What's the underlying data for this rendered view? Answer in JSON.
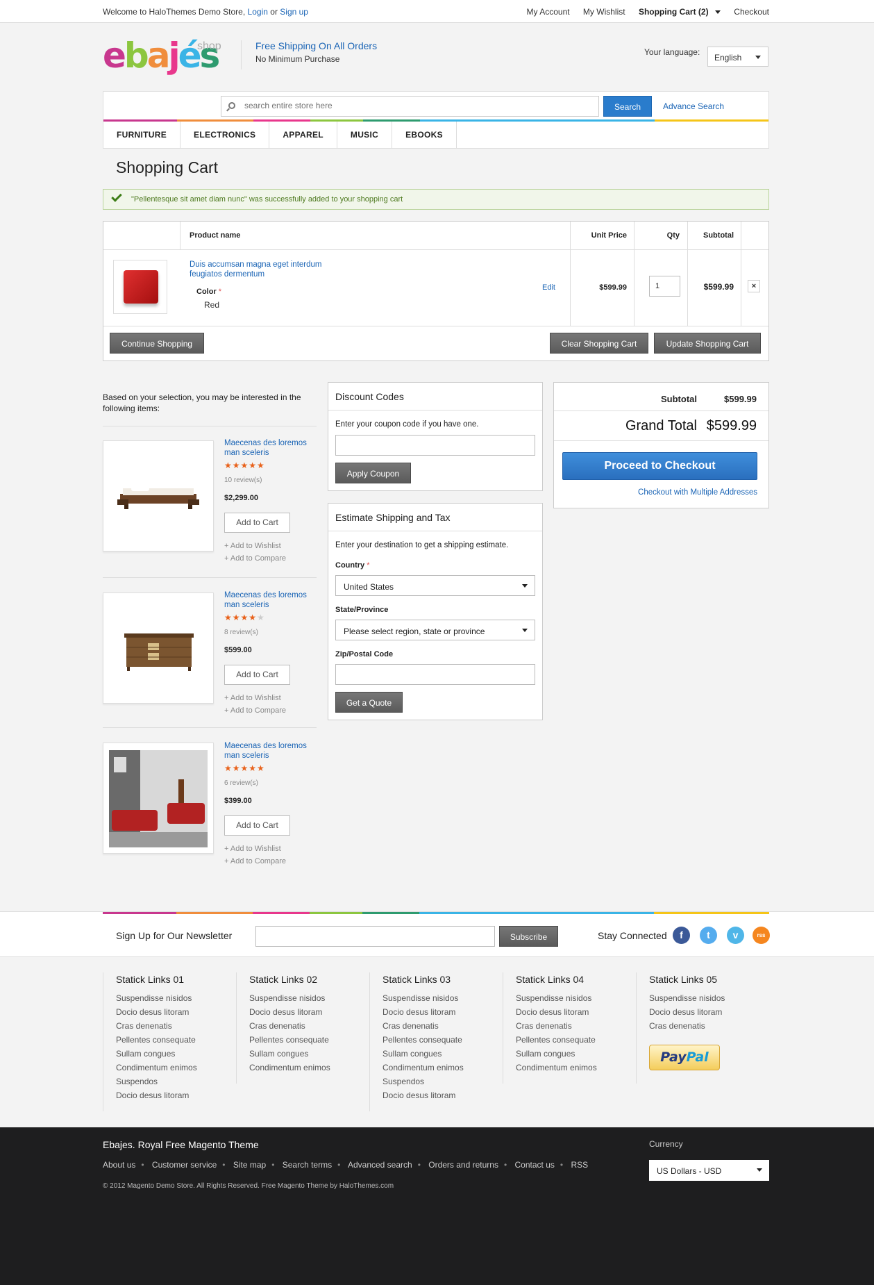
{
  "topbar": {
    "welcome": "Welcome to HaloThemes Demo Store,",
    "login": "Login",
    "or": "or",
    "signup": "Sign up",
    "my_account": "My Account",
    "my_wishlist": "My Wishlist",
    "shopping_cart": "Shopping Cart (2)",
    "checkout": "Checkout"
  },
  "header": {
    "logo_text": "ebajés",
    "logo_suffix": "shop",
    "shipping_title": "Free Shipping On All Orders",
    "shipping_sub": "No Minimum Purchase",
    "language_label": "Your language:",
    "language_value": "English"
  },
  "search": {
    "placeholder": "search entire store here",
    "button": "Search",
    "advance": "Advance Search"
  },
  "menu": [
    "FURNITURE",
    "ELECTRONICS",
    "APPAREL",
    "MUSIC",
    "EBOOKS"
  ],
  "cart": {
    "title": "Shopping Cart",
    "success": "\"Pellentesque sit amet diam nunc\" was successfully added to your shopping cart",
    "headers": {
      "product": "Product name",
      "unit_price": "Unit Price",
      "qty": "Qty",
      "subtotal": "Subtotal"
    },
    "item": {
      "name_line1": "Duis accumsan magna eget interdum",
      "name_line2": "feugiatos dermentum",
      "option_label": "Color",
      "option_req": "*",
      "option_value": "Red",
      "edit": "Edit",
      "unit_price": "$599.99",
      "qty": "1",
      "subtotal": "$599.99",
      "remove": "×"
    },
    "continue": "Continue Shopping",
    "clear": "Clear Shopping Cart",
    "update": "Update Shopping Cart"
  },
  "crosssell": {
    "intro": "Based on your selection, you may be interested in the following items:",
    "items": [
      {
        "name1": "Maecenas des loremos",
        "name2": "man sceleris",
        "rating": 5,
        "reviews": "10 review(s)",
        "price": "$2,299.00",
        "add": "Add to Cart",
        "wishlist": "Add to Wishlist",
        "compare": "Add to Compare"
      },
      {
        "name1": "Maecenas des loremos",
        "name2": "man sceleris",
        "rating": 4,
        "reviews": "8 review(s)",
        "price": "$599.00",
        "add": "Add to Cart",
        "wishlist": "Add to Wishlist",
        "compare": "Add to Compare"
      },
      {
        "name1": "Maecenas des loremos",
        "name2": "man sceleris",
        "rating": 5,
        "reviews": "6 review(s)",
        "price": "$399.00",
        "add": "Add to Cart",
        "wishlist": "Add to Wishlist",
        "compare": "Add to Compare"
      }
    ]
  },
  "discount": {
    "title": "Discount Codes",
    "text": "Enter your coupon code if you have one.",
    "button": "Apply Coupon"
  },
  "shipping": {
    "title": "Estimate Shipping and Tax",
    "text": "Enter your destination to get a shipping estimate.",
    "country_label": "Country",
    "country_value": "United States",
    "state_label": "State/Province",
    "state_value": "Please select region, state or province",
    "zip_label": "Zip/Postal Code",
    "button": "Get a Quote",
    "required": "*"
  },
  "totals": {
    "subtotal_label": "Subtotal",
    "subtotal_value": "$599.99",
    "grand_label": "Grand Total",
    "grand_value": "$599.99",
    "checkout": "Proceed to Checkout",
    "multi": "Checkout with Multiple Addresses"
  },
  "newsletter": {
    "label": "Sign Up for Our Newsletter",
    "button": "Subscribe",
    "stay": "Stay Connected",
    "social": [
      "f",
      "t",
      "v",
      "rss"
    ]
  },
  "footer_columns": [
    {
      "title": "Statick Links 01",
      "links": [
        "Suspendisse nisidos",
        "Docio desus litoram",
        "Cras denenatis",
        "Pellentes consequate",
        "Sullam congues",
        "Condimentum enimos",
        "Suspendos",
        "Docio desus litoram"
      ]
    },
    {
      "title": "Statick Links 02",
      "links": [
        "Suspendisse nisidos",
        "Docio desus litoram",
        "Cras denenatis",
        "Pellentes consequate",
        "Sullam congues",
        "Condimentum enimos"
      ]
    },
    {
      "title": "Statick Links 03",
      "links": [
        "Suspendisse nisidos",
        "Docio desus litoram",
        "Cras denenatis",
        "Pellentes consequate",
        "Sullam congues",
        "Condimentum enimos",
        "Suspendos",
        "Docio desus litoram"
      ]
    },
    {
      "title": "Statick Links 04",
      "links": [
        "Suspendisse nisidos",
        "Docio desus litoram",
        "Cras denenatis",
        "Pellentes consequate",
        "Sullam congues",
        "Condimentum enimos"
      ]
    },
    {
      "title": "Statick Links 05",
      "links": [
        "Suspendisse nisidos",
        "Docio desus litoram",
        "Cras denenatis"
      ]
    }
  ],
  "paypal": {
    "pay": "Pay",
    "pal": "Pal"
  },
  "bottom": {
    "brand": "Ebajes. Royal Free Magento Theme",
    "links": [
      "About us",
      "Customer service",
      "Site map",
      "Search terms",
      "Advanced search",
      "Orders and returns",
      "Contact us",
      "RSS"
    ],
    "copyright": "© 2012 Magento Demo Store. All Rights Reserved. Free Magento Theme by HaloThemes.com",
    "currency_label": "Currency",
    "currency_value": "US Dollars - USD"
  },
  "colors": {
    "accent_blue": "#2a7ccc",
    "link_blue": "#1a64b5",
    "stripe": [
      "#c8378e",
      "#f08d3c",
      "#e8378c",
      "#8cc63f",
      "#2e9b6f",
      "#3ab4e6",
      "#f5c518"
    ]
  }
}
